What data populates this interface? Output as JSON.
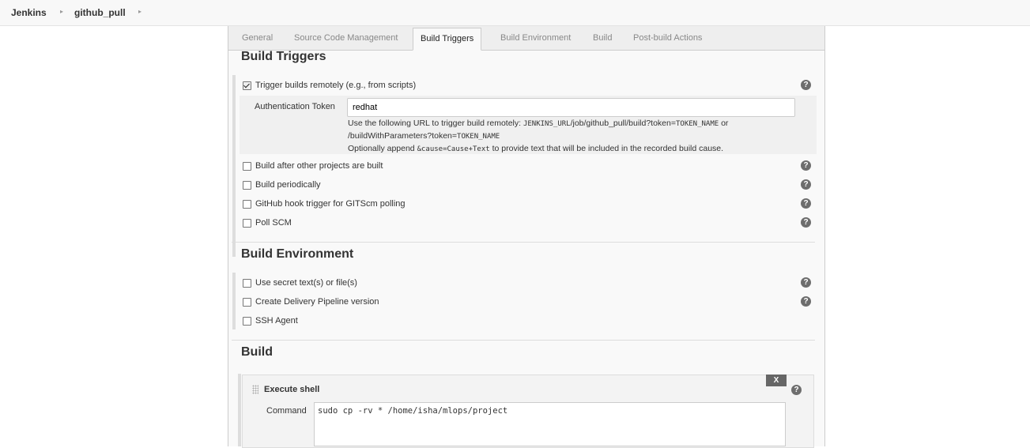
{
  "breadcrumb": {
    "root": "Jenkins",
    "project": "github_pull"
  },
  "tabs": [
    {
      "label": "General"
    },
    {
      "label": "Source Code Management"
    },
    {
      "label": "Build Triggers"
    },
    {
      "label": "Build Environment"
    },
    {
      "label": "Build"
    },
    {
      "label": "Post-build Actions"
    }
  ],
  "active_tab": "Build Triggers",
  "build_triggers": {
    "title": "Build Triggers",
    "trigger_remote": {
      "label": "Trigger builds remotely (e.g., from scripts)",
      "checked": true
    },
    "auth_token": {
      "label": "Authentication Token",
      "value": "redhat",
      "desc_line1_a": "Use the following URL to trigger build remotely: ",
      "desc_line1_code1": "JENKINS_URL",
      "desc_line1_b": "/job/github_pull/build?token=",
      "desc_line1_code2": "TOKEN_NAME",
      "desc_line1_c": " or",
      "desc_line2_a": "/buildWithParameters?token=",
      "desc_line2_code": "TOKEN_NAME",
      "desc_line3_a": "Optionally append ",
      "desc_line3_code": "&cause=Cause+Text",
      "desc_line3_b": " to provide text that will be included in the recorded build cause."
    },
    "options": [
      {
        "label": "Build after other projects are built",
        "checked": false
      },
      {
        "label": "Build periodically",
        "checked": false
      },
      {
        "label": "GitHub hook trigger for GITScm polling",
        "checked": false
      },
      {
        "label": "Poll SCM",
        "checked": false
      }
    ]
  },
  "build_environment": {
    "title": "Build Environment",
    "options": [
      {
        "label": "Use secret text(s) or file(s)",
        "checked": false
      },
      {
        "label": "Create Delivery Pipeline version",
        "checked": false
      },
      {
        "label": "SSH Agent",
        "checked": false
      }
    ]
  },
  "build": {
    "title": "Build",
    "step": {
      "title": "Execute shell",
      "delete_label": "X",
      "command_label": "Command",
      "command": "sudo cp -rv * /home/isha/mlops/project"
    }
  },
  "help_glyph": "?",
  "icons": [
    "help-icon",
    "checkbox-checked",
    "checkbox-unchecked",
    "drag-handle-icon",
    "breadcrumb-separator"
  ]
}
